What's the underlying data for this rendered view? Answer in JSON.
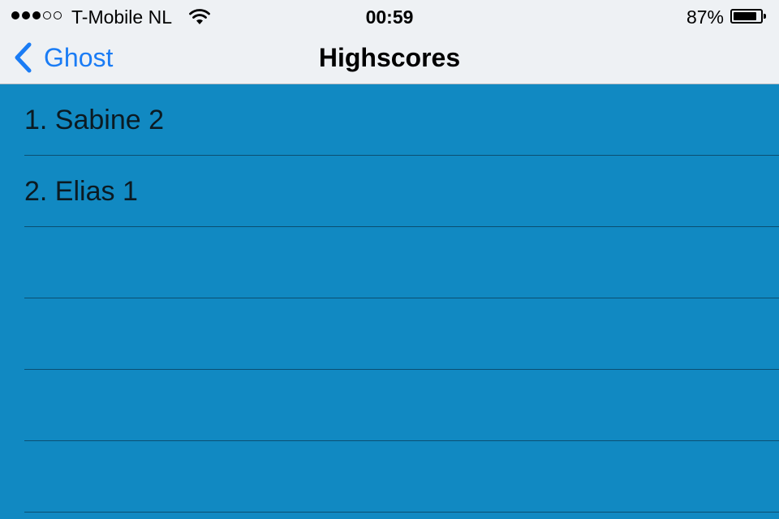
{
  "status_bar": {
    "signal_dots_filled": 3,
    "signal_dots_total": 5,
    "carrier": "T-Mobile NL",
    "time": "00:59",
    "battery_percent": "87%",
    "battery_level": 0.87
  },
  "nav": {
    "back_label": "Ghost",
    "title": "Highscores"
  },
  "list": {
    "rows": [
      {
        "text": "1. Sabine 2"
      },
      {
        "text": "2. Elias 1"
      },
      {
        "text": ""
      },
      {
        "text": ""
      },
      {
        "text": ""
      },
      {
        "text": ""
      }
    ]
  },
  "colors": {
    "list_background": "#1189c2",
    "separator": "#0b4f72",
    "nav_background": "#eef1f4",
    "accent": "#1a7cf5"
  },
  "icons": {
    "signal": "signal-dots-icon",
    "wifi": "wifi-icon",
    "battery": "battery-icon",
    "back": "chevron-left-icon"
  }
}
